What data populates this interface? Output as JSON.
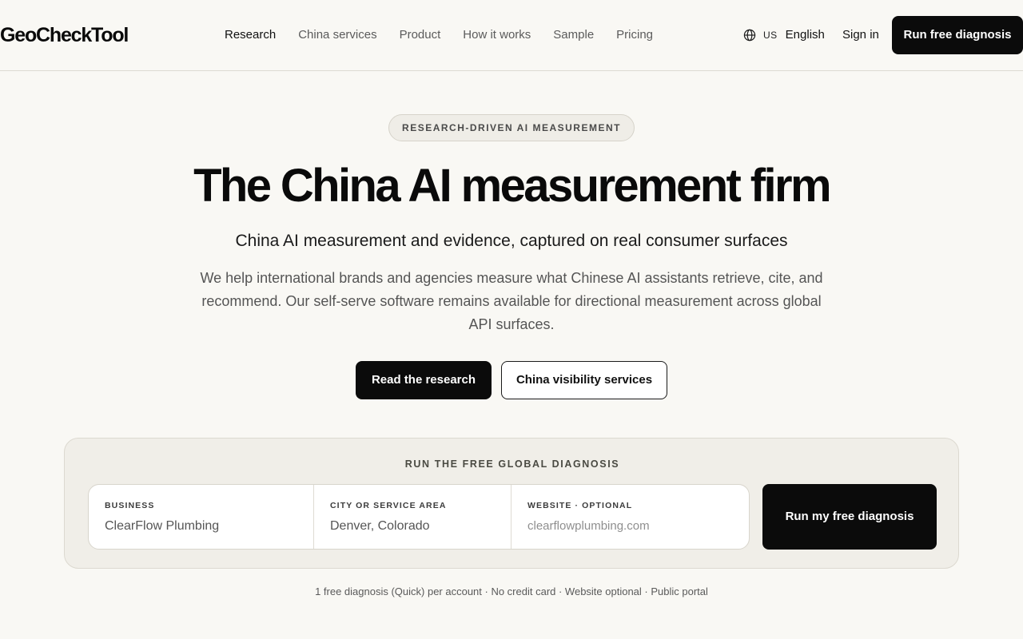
{
  "header": {
    "logo": "GeoCheckTool",
    "nav": [
      {
        "label": "Research",
        "active": true
      },
      {
        "label": "China services",
        "active": false
      },
      {
        "label": "Product",
        "active": false
      },
      {
        "label": "How it works",
        "active": false
      },
      {
        "label": "Sample",
        "active": false
      },
      {
        "label": "Pricing",
        "active": false
      }
    ],
    "language": {
      "icon": "globe-icon",
      "code": "US",
      "name": "English"
    },
    "sign_in": "Sign in",
    "cta": "Run free diagnosis"
  },
  "hero": {
    "eyebrow": "RESEARCH-DRIVEN AI MEASUREMENT",
    "title": "The China AI measurement firm",
    "subtitle": "China AI measurement and evidence, captured on real consumer surfaces",
    "body": "We help international brands and agencies measure what Chinese AI assistants retrieve, cite, and recommend. Our self-serve software remains available for directional measurement across global API surfaces.",
    "primary_button": "Read the research",
    "secondary_button": "China visibility services"
  },
  "diagnosis": {
    "title": "RUN THE FREE GLOBAL DIAGNOSIS",
    "fields": [
      {
        "label": "BUSINESS",
        "value": "ClearFlow Plumbing",
        "placeholder": ""
      },
      {
        "label": "CITY OR SERVICE AREA",
        "value": "Denver, Colorado",
        "placeholder": ""
      },
      {
        "label": "WEBSITE · OPTIONAL",
        "value": "",
        "placeholder": "clearflowplumbing.com"
      }
    ],
    "submit": "Run my free diagnosis",
    "footnote": "1 free diagnosis (Quick) per account · No credit card · Website optional · Public portal"
  },
  "colors": {
    "background": "#f9f8f4",
    "panel": "#f0eee8",
    "primary": "#0b0b0b",
    "text": "#111111",
    "muted": "#555555"
  }
}
